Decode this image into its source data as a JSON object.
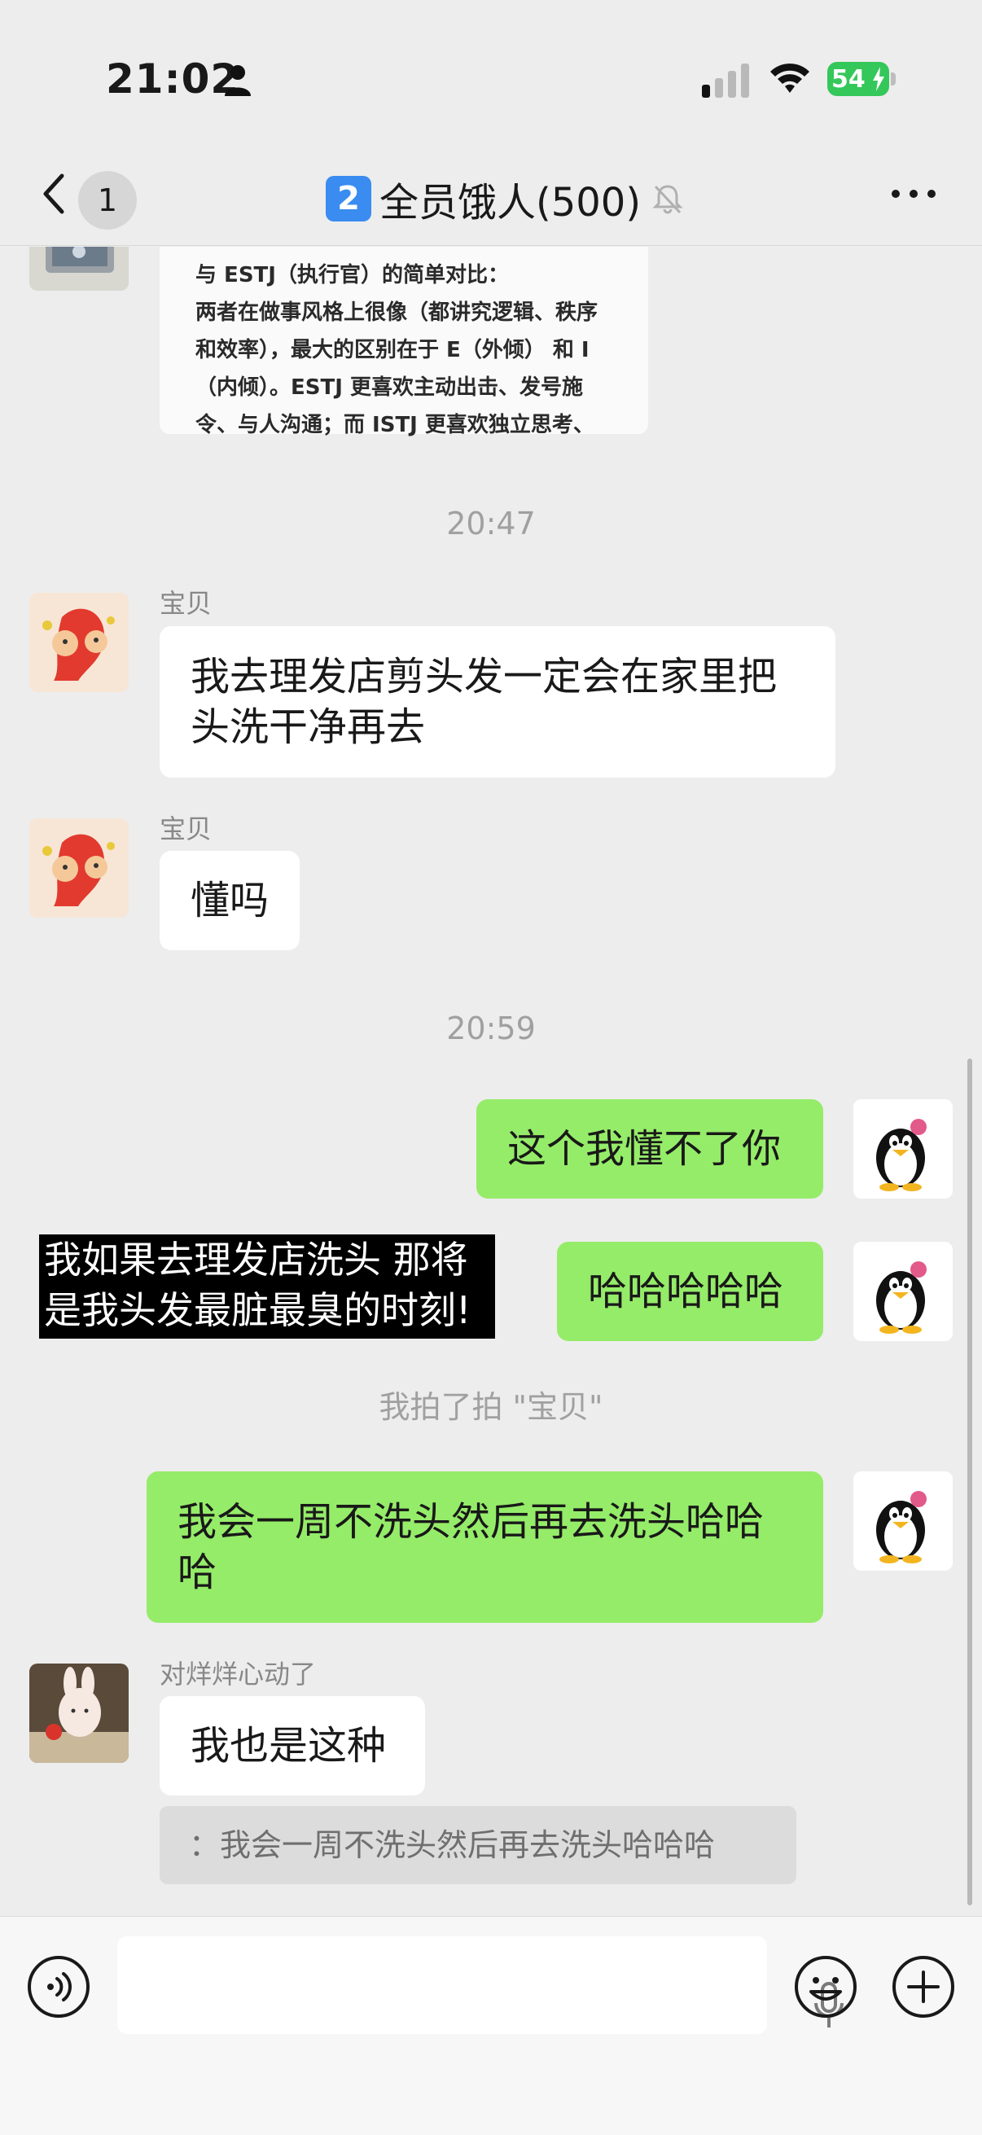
{
  "status_bar": {
    "time": "21:02",
    "battery": "54"
  },
  "header": {
    "back_count": "1",
    "group_badge": "2",
    "title": "全员饿人(500)"
  },
  "doc_card": {
    "lines": [
      "与 ESTJ（执行官）的简单对比：",
      "两者在做事风格上很像（都讲究逻辑、秩序",
      "和效率），最大的区别在于 E（外倾） 和 I",
      "（内倾）。ESTJ 更喜欢主动出击、发号施",
      "令、与人沟通；而 ISTJ 更喜欢独立思考、"
    ]
  },
  "timestamps": [
    "20:47",
    "20:59"
  ],
  "messages": [
    {
      "side": "left",
      "sender": "宝贝",
      "text_lines": [
        "我去理发店剪头发一定会在家里把",
        "头洗干净再去"
      ]
    },
    {
      "side": "left",
      "sender": "宝贝",
      "text_lines": [
        "懂吗"
      ]
    },
    {
      "side": "right",
      "text_lines": [
        "这个我懂不了你"
      ]
    },
    {
      "side": "right",
      "text_lines": [
        "哈哈哈哈哈"
      ]
    },
    {
      "side": "right",
      "text_lines": [
        "我会一周不洗头然后再去洗头哈哈",
        "哈"
      ]
    },
    {
      "side": "left",
      "sender": "对烊烊心动了",
      "text_lines": [
        "我也是这种"
      ]
    }
  ],
  "overlay_caption": [
    "我如果去理发店洗头 那将",
    "是我头发最脏最臭的时刻!"
  ],
  "system_note": "我拍了拍 \"宝贝\"",
  "quote": "：我会一周不洗头然后再去洗头哈哈哈",
  "icons": {
    "back": "chevron-left-icon",
    "mute": "bell-slash-icon",
    "more": "ellipsis-icon",
    "voice": "voice-icon",
    "mic": "microphone-icon",
    "emoji": "emoji-icon",
    "plus": "plus-icon"
  },
  "colors": {
    "background": "#ededed",
    "bubble_self": "#95ec69",
    "bubble_other": "#ffffff",
    "badge_blue": "#3a8cf0",
    "battery_green": "#34c759"
  }
}
